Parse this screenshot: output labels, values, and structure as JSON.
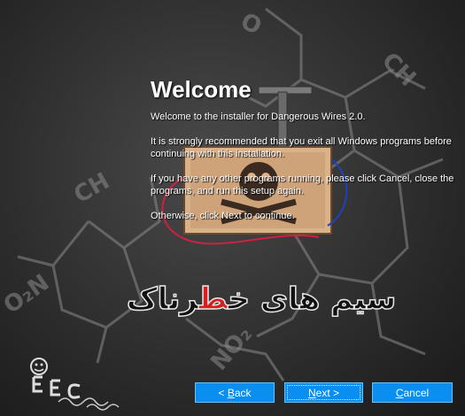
{
  "wizard": {
    "title": "Welcome",
    "paragraphs": [
      "Welcome to the installer for Dangerous Wires 2.0.",
      "It is strongly recommended that you exit all Windows programs before continuing with this installation.",
      "If you have any other programs running, please click Cancel, close the programs, and run this setup again.",
      "Otherwise, click Next to continue."
    ]
  },
  "logo": {
    "text_left": "سیم های خ",
    "text_red": "ط",
    "text_right": "رناک"
  },
  "buttons": {
    "back": {
      "prefix": "< ",
      "accel": "B",
      "rest": "ack"
    },
    "next": {
      "accel": "N",
      "rest": "ext >"
    },
    "cancel": {
      "accel": "C",
      "rest": "ancel"
    }
  },
  "colors": {
    "button_blue": "#0a8ef0",
    "logo_red": "#d81e1e"
  }
}
